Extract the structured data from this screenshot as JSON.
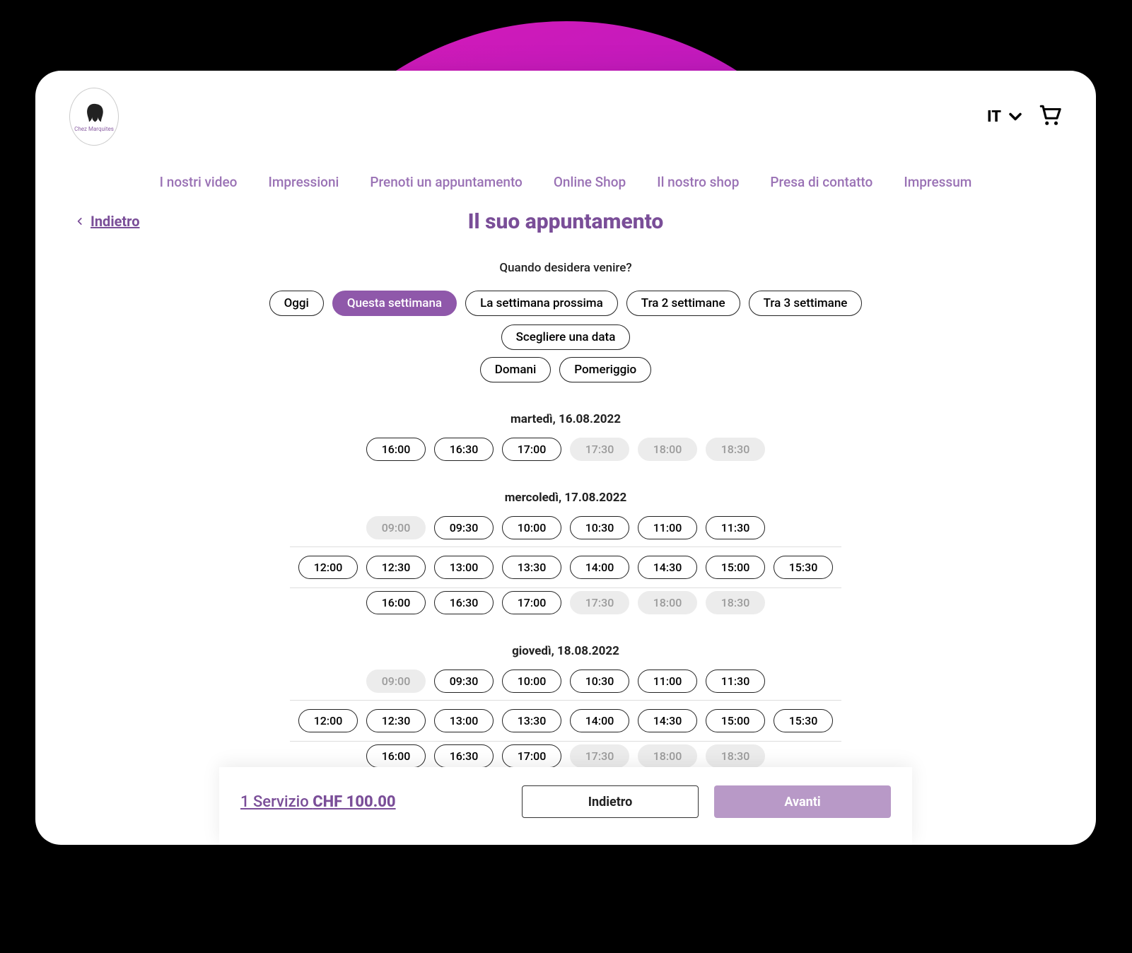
{
  "logo_text": "Chez Marquites",
  "lang": {
    "label": "IT"
  },
  "nav": [
    "I nostri video",
    "Impressioni",
    "Prenoti un appuntamento",
    "Online Shop",
    "Il nostro shop",
    "Presa di contatto",
    "Impressum"
  ],
  "back_label": "Indietro",
  "page_title": "Il suo appuntamento",
  "subtitle": "Quando desidera venire?",
  "chips_row1": [
    {
      "label": "Oggi",
      "selected": false
    },
    {
      "label": "Questa settimana",
      "selected": true
    },
    {
      "label": "La settimana prossima",
      "selected": false
    },
    {
      "label": "Tra 2 settimane",
      "selected": false
    },
    {
      "label": "Tra 3 settimane",
      "selected": false
    },
    {
      "label": "Scegliere una data",
      "selected": false
    }
  ],
  "chips_row2": [
    {
      "label": "Domani",
      "selected": false
    },
    {
      "label": "Pomeriggio",
      "selected": false
    }
  ],
  "days": [
    {
      "label": "martedì, 16.08.2022",
      "rows": [
        [
          {
            "t": "16:00",
            "d": false
          },
          {
            "t": "16:30",
            "d": false
          },
          {
            "t": "17:00",
            "d": false
          },
          {
            "t": "17:30",
            "d": true
          },
          {
            "t": "18:00",
            "d": true
          },
          {
            "t": "18:30",
            "d": true
          }
        ]
      ]
    },
    {
      "label": "mercoledì, 17.08.2022",
      "rows": [
        [
          {
            "t": "09:00",
            "d": true
          },
          {
            "t": "09:30",
            "d": false
          },
          {
            "t": "10:00",
            "d": false
          },
          {
            "t": "10:30",
            "d": false
          },
          {
            "t": "11:00",
            "d": false
          },
          {
            "t": "11:30",
            "d": false
          }
        ],
        [
          {
            "t": "12:00",
            "d": false
          },
          {
            "t": "12:30",
            "d": false
          },
          {
            "t": "13:00",
            "d": false
          },
          {
            "t": "13:30",
            "d": false
          },
          {
            "t": "14:00",
            "d": false
          },
          {
            "t": "14:30",
            "d": false
          },
          {
            "t": "15:00",
            "d": false
          },
          {
            "t": "15:30",
            "d": false
          }
        ],
        [
          {
            "t": "16:00",
            "d": false
          },
          {
            "t": "16:30",
            "d": false
          },
          {
            "t": "17:00",
            "d": false
          },
          {
            "t": "17:30",
            "d": true
          },
          {
            "t": "18:00",
            "d": true
          },
          {
            "t": "18:30",
            "d": true
          }
        ]
      ]
    },
    {
      "label": "giovedì, 18.08.2022",
      "rows": [
        [
          {
            "t": "09:00",
            "d": true
          },
          {
            "t": "09:30",
            "d": false
          },
          {
            "t": "10:00",
            "d": false
          },
          {
            "t": "10:30",
            "d": false
          },
          {
            "t": "11:00",
            "d": false
          },
          {
            "t": "11:30",
            "d": false
          }
        ],
        [
          {
            "t": "12:00",
            "d": false
          },
          {
            "t": "12:30",
            "d": false
          },
          {
            "t": "13:00",
            "d": false
          },
          {
            "t": "13:30",
            "d": false
          },
          {
            "t": "14:00",
            "d": false
          },
          {
            "t": "14:30",
            "d": false
          },
          {
            "t": "15:00",
            "d": false
          },
          {
            "t": "15:30",
            "d": false
          }
        ],
        [
          {
            "t": "16:00",
            "d": false
          },
          {
            "t": "16:30",
            "d": false
          },
          {
            "t": "17:00",
            "d": false
          },
          {
            "t": "17:30",
            "d": true
          },
          {
            "t": "18:00",
            "d": true
          },
          {
            "t": "18:30",
            "d": true
          }
        ]
      ]
    }
  ],
  "footer": {
    "summary_prefix": "1 Servizio ",
    "summary_price": "CHF 100.00",
    "back": "Indietro",
    "next": "Avanti"
  }
}
